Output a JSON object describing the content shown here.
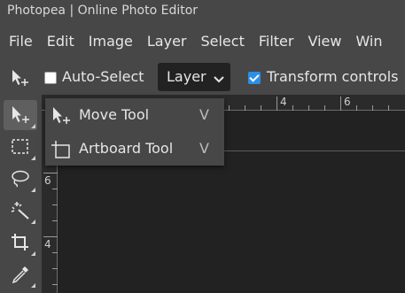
{
  "window": {
    "title": "Photopea | Online Photo Editor"
  },
  "menu": {
    "items": [
      "File",
      "Edit",
      "Image",
      "Layer",
      "Select",
      "Filter",
      "View",
      "Win"
    ]
  },
  "options": {
    "auto_select_label": "Auto-Select",
    "auto_select_checked": false,
    "select_value": "Layer",
    "transform_label": "Transform controls",
    "transform_checked": true
  },
  "flyout": {
    "items": [
      {
        "label": "Move Tool",
        "shortcut": "V",
        "icon": "move-arrow-icon"
      },
      {
        "label": "Artboard Tool",
        "shortcut": "V",
        "icon": "artboard-icon"
      }
    ]
  },
  "tools": [
    "move-tool",
    "marquee-tool",
    "lasso-tool",
    "magic-wand-tool",
    "crop-tool",
    "eyedropper-tool"
  ],
  "ruler": {
    "top_labels": [
      "4",
      "6"
    ],
    "left_labels": [
      "6",
      "4"
    ]
  },
  "colors": {
    "accent": "#2b8fe8",
    "panel": "#474747",
    "canvas": "#222222"
  }
}
